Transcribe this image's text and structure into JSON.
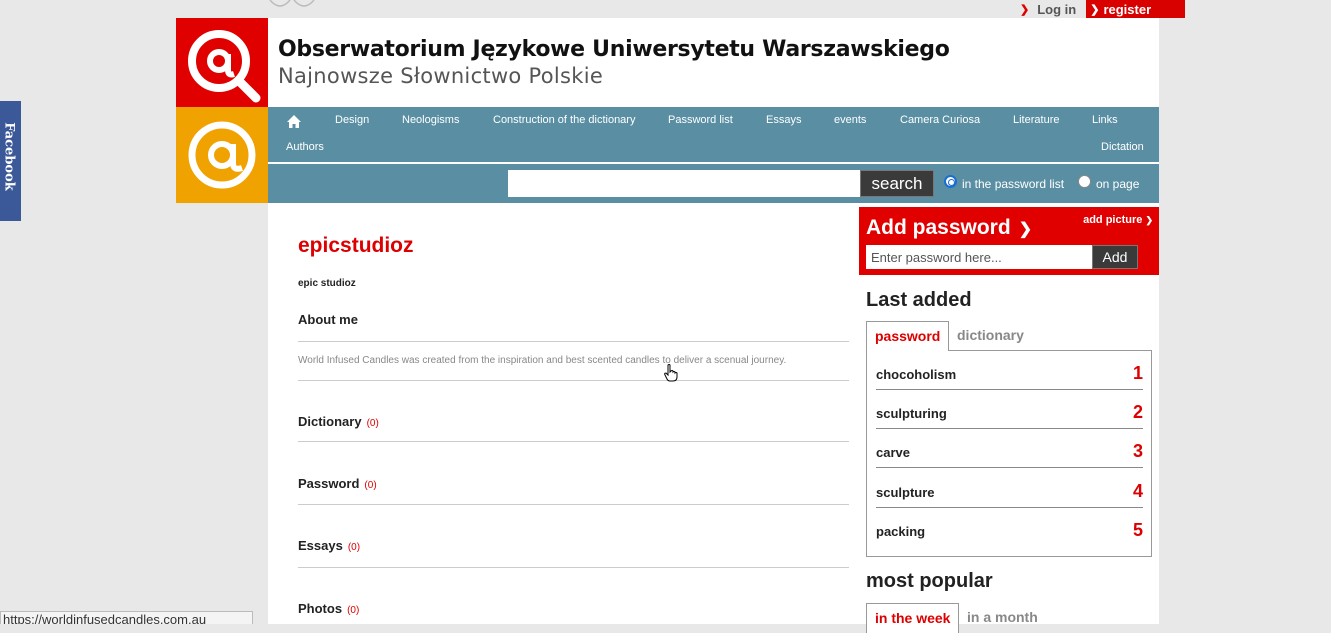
{
  "social": {
    "facebook_label": "Facebook"
  },
  "top": {
    "login_label": "Log in",
    "register_label": "register"
  },
  "header": {
    "title": "Obserwatorium Językowe Uniwersytetu Warszawskiego",
    "subtitle": "Najnowsze Słownictwo Polskie"
  },
  "nav": {
    "home_icon": "home-icon",
    "items": [
      "Design",
      "Neologisms",
      "Construction of the dictionary",
      "Password list",
      "Essays",
      "events",
      "Camera Curiosa",
      "Literature",
      "Links",
      "Authors",
      "Dictation"
    ]
  },
  "search": {
    "value": "",
    "button_label": "search",
    "option1": "in the password list",
    "option2": "on page",
    "selected": "in the password list"
  },
  "profile": {
    "username": "epicstudioz",
    "display_name": "epic studioz",
    "about_heading": "About me",
    "about_text": "World Infused Candles was created from the inspiration and best scented candles to deliver a scenual journey.",
    "sections": [
      {
        "label": "Dictionary",
        "count": "(0)"
      },
      {
        "label": "Password",
        "count": "(0)"
      },
      {
        "label": "Essays",
        "count": "(0)"
      },
      {
        "label": "Photos",
        "count": "(0)"
      }
    ]
  },
  "sidebar": {
    "add_password": {
      "title": "Add password",
      "add_picture_label": "add picture",
      "placeholder": "Enter password here...",
      "button_label": "Add"
    },
    "last_added": {
      "heading": "Last added",
      "tabs": [
        "password",
        "dictionary"
      ],
      "active_tab": "password",
      "items": [
        {
          "word": "chocoholism",
          "rank": "1"
        },
        {
          "word": "sculpturing",
          "rank": "2"
        },
        {
          "word": "carve",
          "rank": "3"
        },
        {
          "word": "sculpture",
          "rank": "4"
        },
        {
          "word": "packing",
          "rank": "5"
        }
      ]
    },
    "most_popular": {
      "heading": "most popular",
      "tabs": [
        "in the week",
        "in a month"
      ],
      "active_tab": "in the week"
    }
  },
  "statusbar": {
    "url": "https://worldinfusedcandles.com.au"
  },
  "colors": {
    "brand_red": "#e00000",
    "brand_orange": "#f0a200",
    "nav_teal": "#5a8fa3"
  }
}
